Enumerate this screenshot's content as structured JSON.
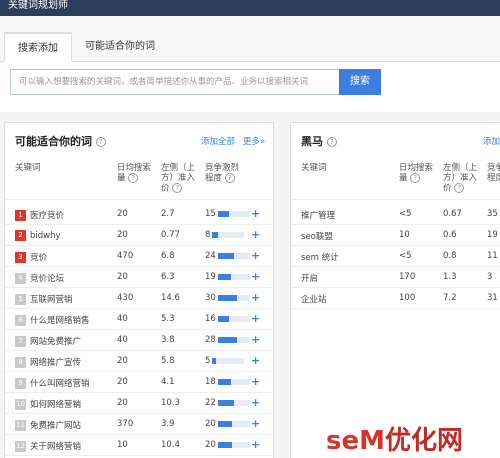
{
  "titlebar": {
    "title": "关键词规划师"
  },
  "tabs": [
    {
      "label": "搜索添加",
      "active": true
    },
    {
      "label": "可能适合你的词",
      "active": false
    }
  ],
  "search": {
    "placeholder": "可以输入想要搜索的关键词，或者简单描述你从事的产品、业务以搜索相关词",
    "button_label": "搜索"
  },
  "left_panel": {
    "title": "可能适合你的词",
    "add_all_label": "添加全部",
    "more_label": "更多»",
    "columns": {
      "keyword": "关键词",
      "avg_search": "日均搜索量",
      "bid": "左侧（上方）准入价",
      "competition": "竞争激烈程度"
    },
    "rows": [
      {
        "rank": "1",
        "keyword": "医疗竞价",
        "avg": "20",
        "bid": "2.7",
        "comp": "15",
        "level": 0.35
      },
      {
        "rank": "2",
        "keyword": "bidwhy",
        "avg": "20",
        "bid": "0.77",
        "comp": "8",
        "level": 0.2
      },
      {
        "rank": "3",
        "keyword": "竞价",
        "avg": "470",
        "bid": "6.8",
        "comp": "24",
        "level": 0.5
      },
      {
        "rank": "4",
        "keyword": "竞价论坛",
        "avg": "20",
        "bid": "6.3",
        "comp": "19",
        "level": 0.4
      },
      {
        "rank": "5",
        "keyword": "互联网营销",
        "avg": "430",
        "bid": "14.6",
        "comp": "30",
        "level": 0.6
      },
      {
        "rank": "6",
        "keyword": "什么是网络销售",
        "avg": "40",
        "bid": "5.3",
        "comp": "16",
        "level": 0.35
      },
      {
        "rank": "7",
        "keyword": "网站免费推广",
        "avg": "40",
        "bid": "3.8",
        "comp": "28",
        "level": 0.6
      },
      {
        "rank": "8",
        "keyword": "网络推广宣传",
        "avg": "20",
        "bid": "5.8",
        "comp": "5",
        "level": 0.12
      },
      {
        "rank": "9",
        "keyword": "什么叫网络营销",
        "avg": "20",
        "bid": "4.1",
        "comp": "18",
        "level": 0.4
      },
      {
        "rank": "10",
        "keyword": "如何网络营销",
        "avg": "20",
        "bid": "10.3",
        "comp": "22",
        "level": 0.5
      },
      {
        "rank": "11",
        "keyword": "免费推广网站",
        "avg": "370",
        "bid": "3.9",
        "comp": "20",
        "level": 0.45
      },
      {
        "rank": "12",
        "keyword": "关于网络营销",
        "avg": "10",
        "bid": "10.4",
        "comp": "20",
        "level": 0.45
      }
    ]
  },
  "right_panel": {
    "title": "黑马",
    "add_label": "添加",
    "columns": {
      "keyword": "关键词",
      "avg_search": "日均搜索量",
      "bid": "左侧（上方）准入价",
      "competition": "竞争激烈程度"
    },
    "rows": [
      {
        "keyword": "推广管理",
        "avg": "<5",
        "bid": "0.67",
        "comp": "35"
      },
      {
        "keyword": "seo联盟",
        "avg": "10",
        "bid": "0.6",
        "comp": "19"
      },
      {
        "keyword": "sem 统计",
        "avg": "<5",
        "bid": "0.8",
        "comp": "11"
      },
      {
        "keyword": "开启",
        "avg": "170",
        "bid": "1.3",
        "comp": "3"
      },
      {
        "keyword": "企业站",
        "avg": "100",
        "bid": "7.2",
        "comp": "31"
      }
    ]
  },
  "watermark": {
    "text_a": "seM",
    "text_b": "优化网"
  }
}
